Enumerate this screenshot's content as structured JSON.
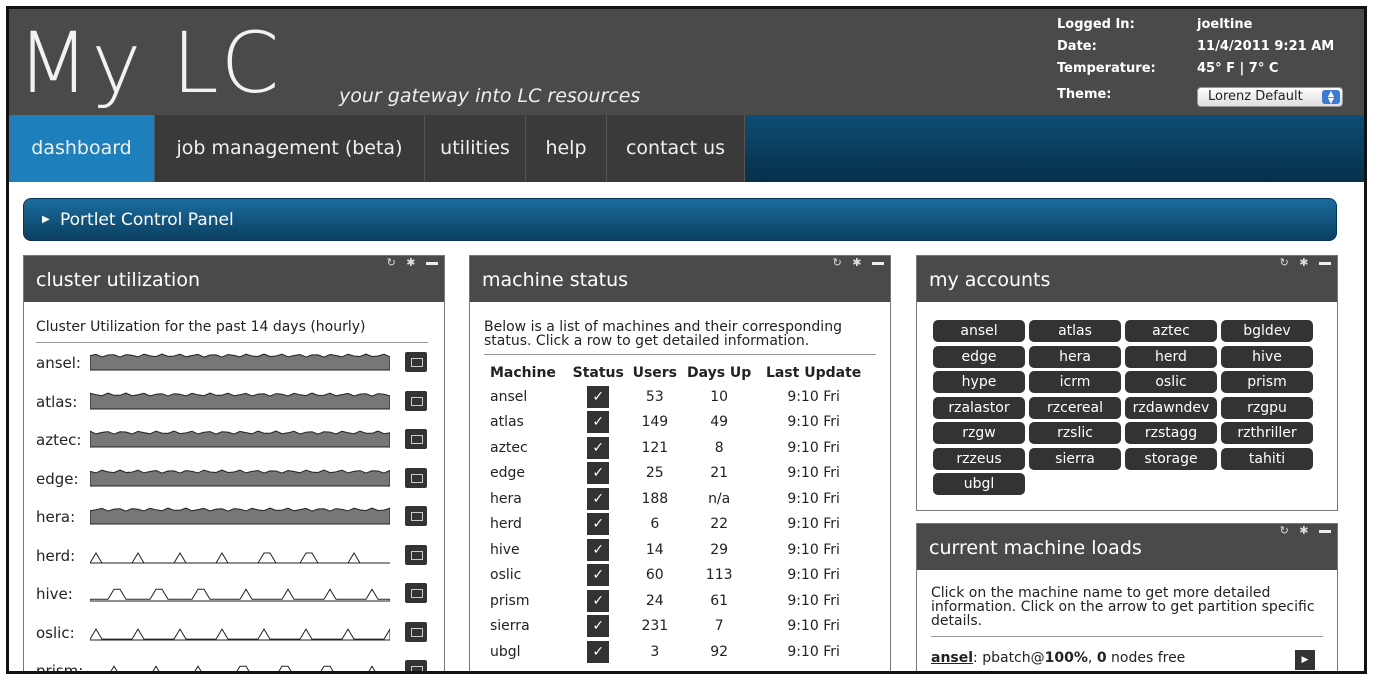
{
  "header": {
    "logo": "My LC",
    "tagline": "your gateway into LC resources",
    "info": [
      {
        "label": "Logged In:",
        "value": "joeltine"
      },
      {
        "label": "Date:",
        "value": "11/4/2011 9:21 AM"
      },
      {
        "label": "Temperature:",
        "value": "45° F | 7° C"
      }
    ],
    "theme_label": "Theme:",
    "theme_value": "Lorenz Default"
  },
  "nav": {
    "tabs": [
      {
        "label": "dashboard",
        "active": true
      },
      {
        "label": "job management (beta)"
      },
      {
        "label": "utilities"
      },
      {
        "label": "help"
      },
      {
        "label": "contact us"
      }
    ]
  },
  "control_panel": {
    "label": "Portlet Control Panel"
  },
  "portlets": {
    "controls": {
      "refresh": "↻",
      "settings": "✱"
    },
    "cluster_utilization": {
      "title": "cluster utilization",
      "subtitle": "Cluster Utilization for the past 14 days (hourly)",
      "rows": [
        {
          "name": "ansel:",
          "level": 0.8
        },
        {
          "name": "atlas:",
          "level": 0.8
        },
        {
          "name": "aztec:",
          "level": 0.8
        },
        {
          "name": "edge:",
          "level": 0.8
        },
        {
          "name": "hera:",
          "level": 0.8
        },
        {
          "name": "herd:",
          "level": 0.0
        },
        {
          "name": "hive:",
          "level": 0.1
        },
        {
          "name": "oslic:",
          "level": 0.05
        },
        {
          "name": "prism:",
          "level": 0.1
        }
      ]
    },
    "machine_status": {
      "title": "machine status",
      "description": "Below is a list of machines and their corresponding status. Click a row to get detailed information.",
      "columns": [
        "Machine",
        "Status",
        "Users",
        "Days Up",
        "Last Update"
      ],
      "rows": [
        [
          "ansel",
          "✓",
          "53",
          "10",
          "9:10 Fri"
        ],
        [
          "atlas",
          "✓",
          "149",
          "49",
          "9:10 Fri"
        ],
        [
          "aztec",
          "✓",
          "121",
          "8",
          "9:10 Fri"
        ],
        [
          "edge",
          "✓",
          "25",
          "21",
          "9:10 Fri"
        ],
        [
          "hera",
          "✓",
          "188",
          "n/a",
          "9:10 Fri"
        ],
        [
          "herd",
          "✓",
          "6",
          "22",
          "9:10 Fri"
        ],
        [
          "hive",
          "✓",
          "14",
          "29",
          "9:10 Fri"
        ],
        [
          "oslic",
          "✓",
          "60",
          "113",
          "9:10 Fri"
        ],
        [
          "prism",
          "✓",
          "24",
          "61",
          "9:10 Fri"
        ],
        [
          "sierra",
          "✓",
          "231",
          "7",
          "9:10 Fri"
        ],
        [
          "ubgl",
          "✓",
          "3",
          "92",
          "9:10 Fri"
        ]
      ]
    },
    "my_accounts": {
      "title": "my accounts",
      "accounts": [
        "ansel",
        "atlas",
        "aztec",
        "bgldev",
        "edge",
        "hera",
        "herd",
        "hive",
        "hype",
        "icrm",
        "oslic",
        "prism",
        "rzalastor",
        "rzcereal",
        "rzdawndev",
        "rzgpu",
        "rzgw",
        "rzslic",
        "rzstagg",
        "rzthriller",
        "rzzeus",
        "sierra",
        "storage",
        "tahiti",
        "ubgl"
      ]
    },
    "machine_loads": {
      "title": "current machine loads",
      "description": "Click on the machine name to get more detailed information. Click on the arrow to get partition specific details.",
      "first_row": {
        "machine": "ansel",
        "rest1": ": pbatch@",
        "percent": "100%",
        "sep": ", ",
        "free": "0",
        "rest2": " nodes free"
      }
    }
  }
}
